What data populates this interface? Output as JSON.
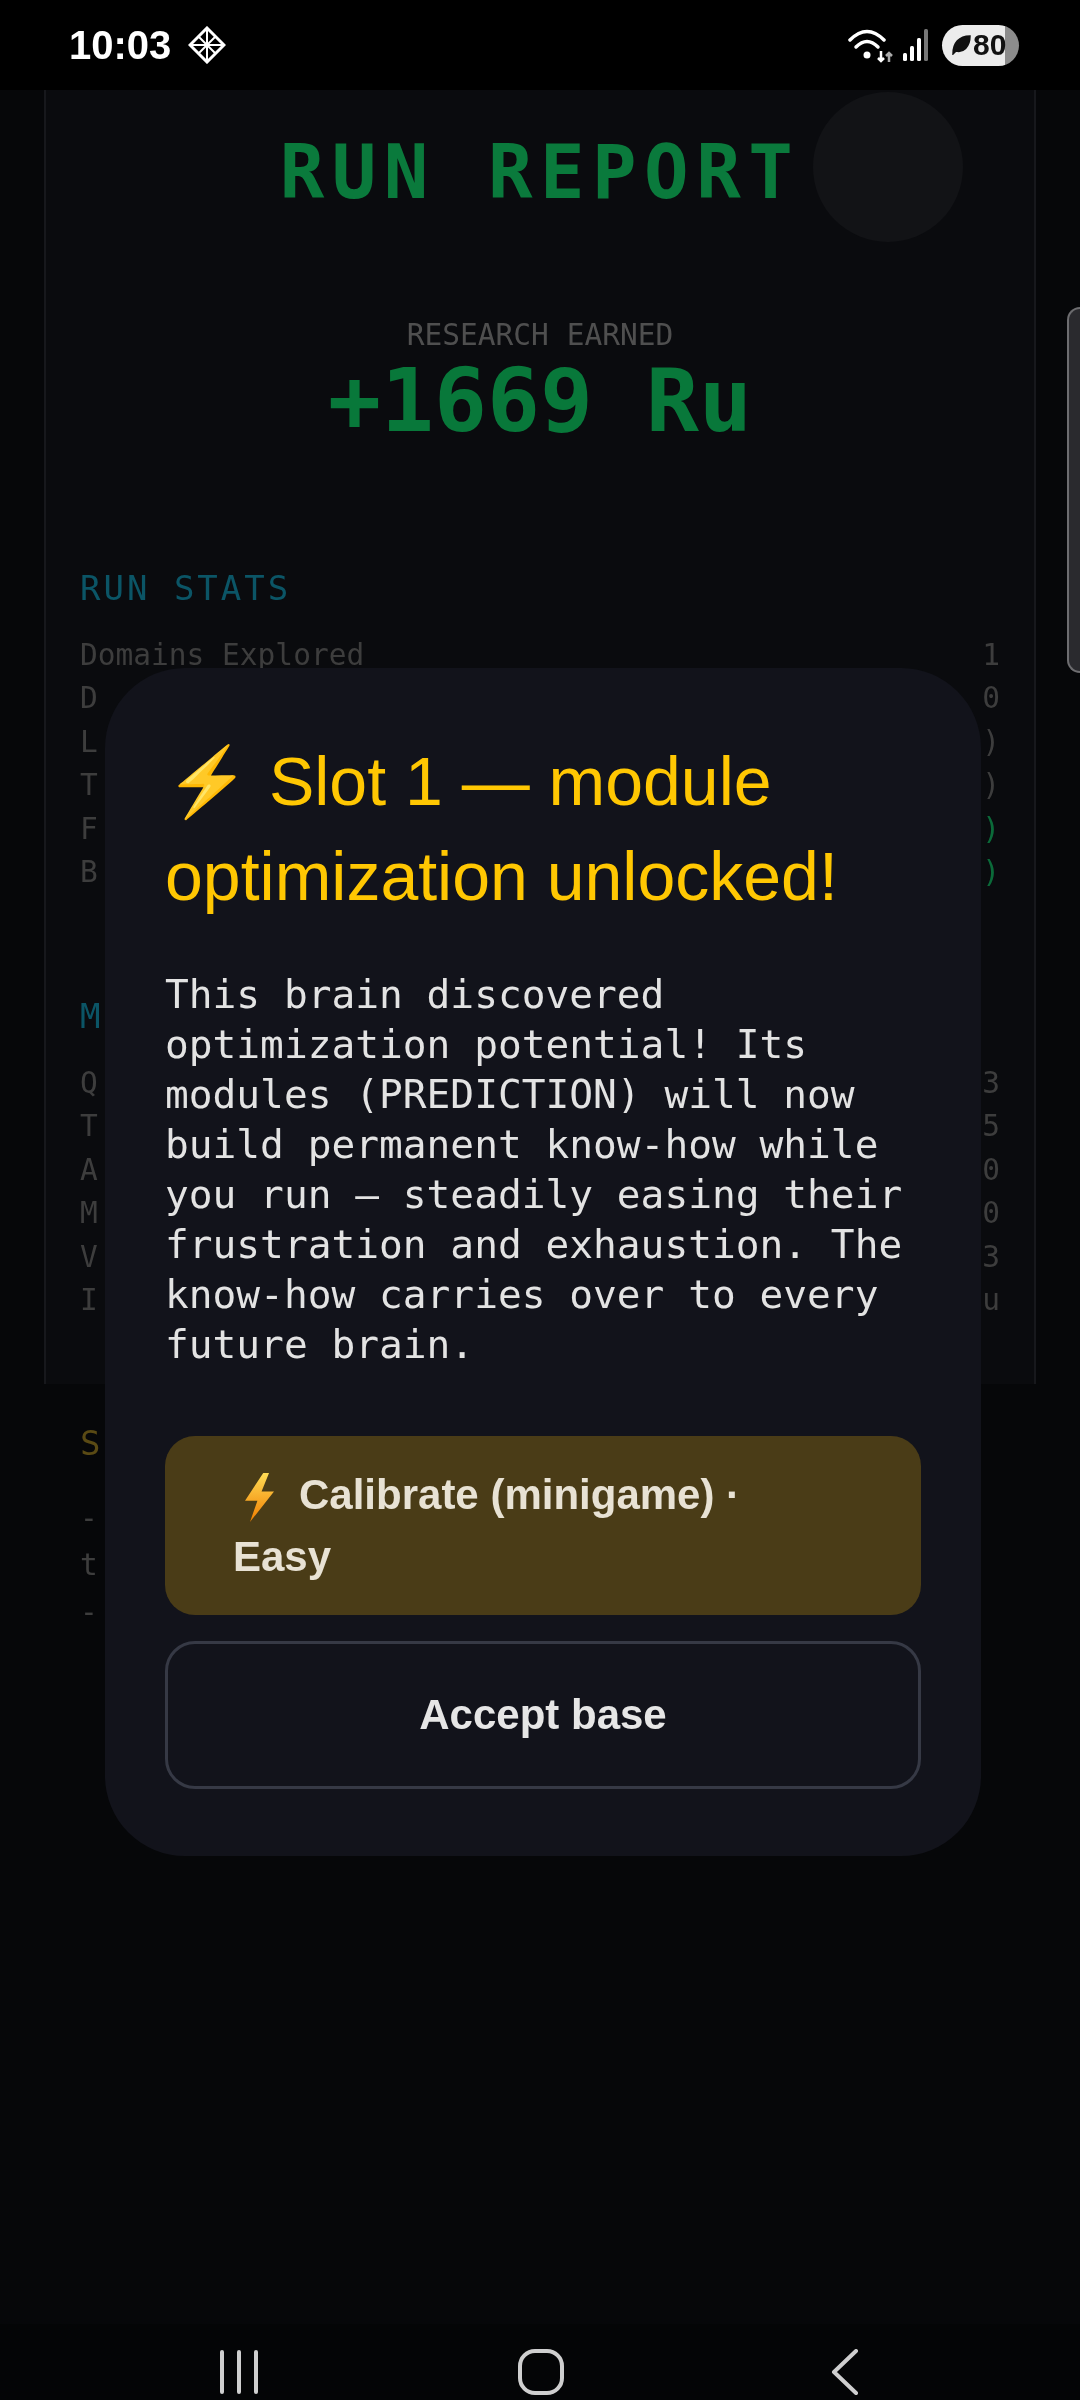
{
  "status_bar": {
    "time": "10:03",
    "battery": "80"
  },
  "report": {
    "title": "RUN REPORT",
    "earned_label": "RESEARCH EARNED",
    "earned_value": "+1669 Ru",
    "sections": [
      {
        "kind": "boxed",
        "heading": "RUN STATS",
        "color": "#0b5566",
        "rows": [
          {
            "label": "Domains Explored",
            "value": "1",
            "highlighted": false
          },
          {
            "label": "D",
            "value": "0",
            "highlighted": false
          },
          {
            "label": "L",
            "value": ")",
            "highlighted": false
          },
          {
            "label": "T",
            "value": ")",
            "highlighted": false
          },
          {
            "label": "F",
            "value": ")",
            "highlighted": true
          },
          {
            "label": "B",
            "value": ")",
            "highlighted": true
          }
        ]
      },
      {
        "kind": "boxed",
        "heading": "M",
        "color": "#0b5566",
        "rows": [
          {
            "label": "Q",
            "value": "3",
            "highlighted": false
          },
          {
            "label": "T",
            "value": "5",
            "highlighted": false
          },
          {
            "label": "A",
            "value": "0",
            "highlighted": false
          },
          {
            "label": "M",
            "value": "0",
            "highlighted": false
          },
          {
            "label": "V",
            "value": "3",
            "highlighted": false
          },
          {
            "label": "I",
            "value": "u",
            "highlighted": false
          }
        ]
      },
      {
        "kind": "open",
        "heading": "S",
        "color": "#5a4a14",
        "rows": [
          {
            "label": "-"
          },
          {
            "label": "t"
          },
          {
            "label": "-"
          }
        ]
      }
    ]
  },
  "dialog": {
    "title": "⚡ Slot 1 — module optimization unlocked!",
    "message": "This brain discovered optimization potential! Its modules (PREDICTION) will now build permanent know-how while you run — steadily easing their frustration and exhaustion. The know-how carries over to every future brain.",
    "buttons": [
      {
        "kind": "primary",
        "label": "Calibrate (minigame) · Easy"
      },
      {
        "kind": "outline",
        "label": "Accept base"
      }
    ]
  }
}
